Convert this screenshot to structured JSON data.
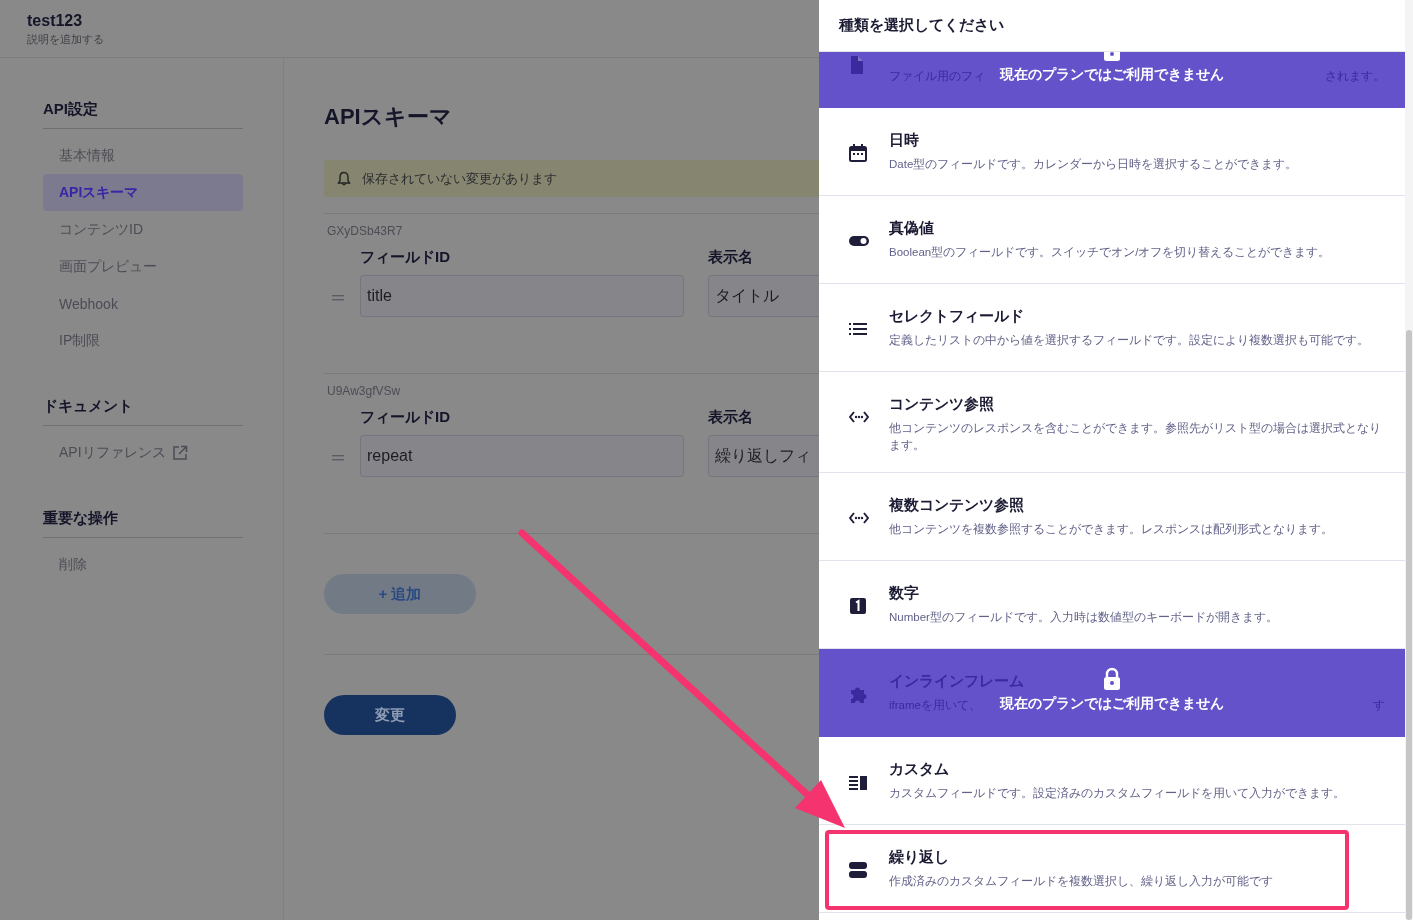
{
  "header": {
    "title": "test123",
    "subtitle": "説明を追加する"
  },
  "sidebar": {
    "groups": [
      {
        "heading": "API設定",
        "items": [
          {
            "label": "基本情報",
            "selected": false,
            "external": false
          },
          {
            "label": "APIスキーマ",
            "selected": true,
            "external": false
          },
          {
            "label": "コンテンツID",
            "selected": false,
            "external": false
          },
          {
            "label": "画面プレビュー",
            "selected": false,
            "external": false
          },
          {
            "label": "Webhook",
            "selected": false,
            "external": false
          },
          {
            "label": "IP制限",
            "selected": false,
            "external": false
          }
        ]
      },
      {
        "heading": "ドキュメント",
        "items": [
          {
            "label": "APIリファレンス",
            "selected": false,
            "external": true
          }
        ]
      },
      {
        "heading": "重要な操作",
        "items": [
          {
            "label": "削除",
            "selected": false,
            "external": false
          }
        ]
      }
    ]
  },
  "main": {
    "title": "APIスキーマ",
    "notice": "保存されていない変更があります",
    "fields": [
      {
        "id": "GXyDSb43R7",
        "id_label": "フィールドID",
        "name_label": "表示名",
        "field_id": "title",
        "display_name": "タイトル"
      },
      {
        "id": "U9Aw3gfVSw",
        "id_label": "フィールドID",
        "name_label": "表示名",
        "field_id": "repeat",
        "display_name": "繰り返しフィ"
      }
    ],
    "add_button": "+ 追加",
    "save_button": "変更"
  },
  "drawer": {
    "title": "種類を選択してください",
    "types": [
      {
        "kind": "file",
        "description": "ファイル用のフィ",
        "description_tail": "されます。",
        "locked": true,
        "lock_message": "現在のプランではご利用できません",
        "highlighted": false
      },
      {
        "kind": "calendar",
        "title": "日時",
        "description": "Date型のフィールドです。カレンダーから日時を選択することができます。",
        "locked": false,
        "highlighted": false
      },
      {
        "kind": "toggle",
        "title": "真偽値",
        "description": "Boolean型のフィールドです。スイッチでオン/オフを切り替えることができます。",
        "locked": false,
        "highlighted": false
      },
      {
        "kind": "list",
        "title": "セレクトフィールド",
        "description": "定義したリストの中から値を選択するフィールドです。設定により複数選択も可能です。",
        "locked": false,
        "highlighted": false
      },
      {
        "kind": "reference",
        "title": "コンテンツ参照",
        "description": "他コンテンツのレスポンスを含むことができます。参照先がリスト型の場合は選択式となります。",
        "locked": false,
        "highlighted": false
      },
      {
        "kind": "reference",
        "title": "複数コンテンツ参照",
        "description": "他コンテンツを複数参照することができます。レスポンスは配列形式となります。",
        "locked": false,
        "highlighted": false
      },
      {
        "kind": "number",
        "title": "数字",
        "description": "Number型のフィールドです。入力時は数値型のキーボードが開きます。",
        "locked": false,
        "highlighted": false
      },
      {
        "kind": "puzzle",
        "title": "インラインフレーム",
        "description": "iframeを用いて、",
        "description_tail": "す",
        "locked": true,
        "lock_message": "現在のプランではご利用できません",
        "highlighted": false
      },
      {
        "kind": "custom",
        "title": "カスタム",
        "description": "カスタムフィールドです。設定済みのカスタムフィールドを用いて入力ができます。",
        "locked": false,
        "highlighted": false
      },
      {
        "kind": "repeat",
        "title": "繰り返し",
        "description": "作成済みのカスタムフィールドを複数選択し、繰り返し入力が可能です",
        "locked": false,
        "highlighted": true
      }
    ]
  }
}
